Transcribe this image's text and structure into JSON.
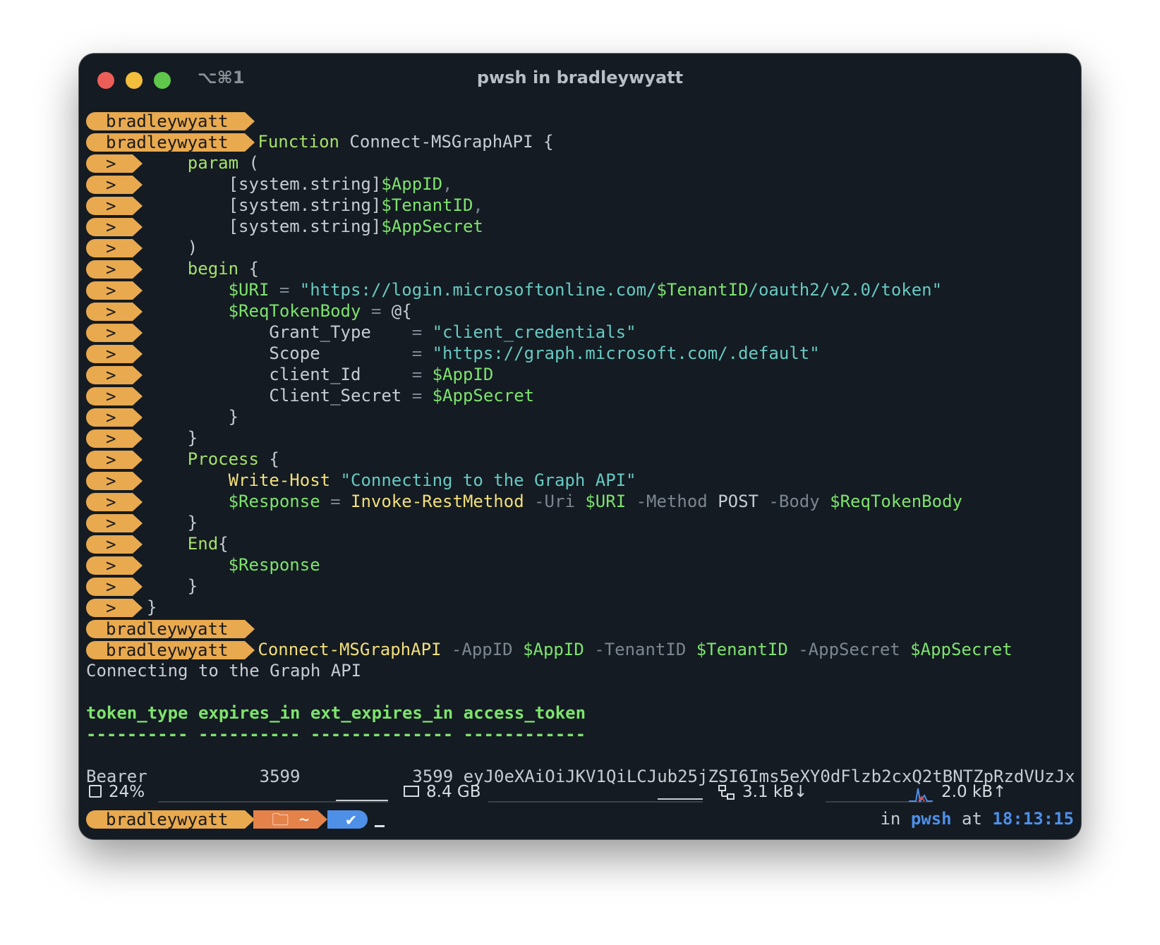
{
  "window": {
    "title": "pwsh in bradleywyatt",
    "shortcut": "⌥⌘1"
  },
  "prompt": {
    "user": "bradleywyatt",
    "cont": ">",
    "dir": "~",
    "ok": "✔",
    "shell_pre": "in ",
    "shell": "pwsh",
    "at": " at ",
    "time": "18:13:15"
  },
  "code": {
    "l1_kw": "Function",
    "l1_name": " Connect-MSGraphAPI {",
    "l2_kw": "param",
    "l2_rest": " (",
    "l3_type": "[system.string]",
    "l3_var": "$AppID",
    "l3_comma": ",",
    "l4_type": "[system.string]",
    "l4_var": "$TenantID",
    "l4_comma": ",",
    "l5_type": "[system.string]",
    "l5_var": "$AppSecret",
    "l6": ")",
    "l7_kw": "begin",
    "l7_rest": " {",
    "l8_var": "$URI",
    "l8_eq": " = ",
    "l8_str1": "\"https://login.microsoftonline.com/",
    "l8_var2": "$TenantID",
    "l8_str2": "/oauth2/v2.0/token\"",
    "l9_var": "$ReqTokenBody",
    "l9_eq": " = ",
    "l9_rest": "@{",
    "l10_key": "Grant_Type    ",
    "l10_eq": "= ",
    "l10_val": "\"client_credentials\"",
    "l11_key": "Scope         ",
    "l11_eq": "= ",
    "l11_val": "\"https://graph.microsoft.com/.default\"",
    "l12_key": "client_Id     ",
    "l12_eq": "= ",
    "l12_val": "$AppID",
    "l13_key": "Client_Secret ",
    "l13_eq": "= ",
    "l13_val": "$AppSecret",
    "l14": "}",
    "l15": "}",
    "l16_kw": "Process",
    "l16_rest": " {",
    "l17_cmd": "Write-Host",
    "l17_str": " \"Connecting to the Graph API\"",
    "l18_var": "$Response",
    "l18_eq": " = ",
    "l18_cmd": "Invoke-RestMethod",
    "l18_p1": " -Uri ",
    "l18_v1": "$URI",
    "l18_p2": " -Method ",
    "l18_v2": "POST",
    "l18_p3": " -Body ",
    "l18_v3": "$ReqTokenBody",
    "l19": "}",
    "l20_kw": "End",
    "l20_rest": "{",
    "l21_var": "$Response",
    "l22": "}",
    "l23": "}"
  },
  "invoke": {
    "cmd": "Connect-MSGraphAPI",
    "p1": " -AppID ",
    "v1": "$AppID",
    "p2": " -TenantID ",
    "v2": "$TenantID",
    "p3": " -AppSecret ",
    "v3": "$AppSecret"
  },
  "output": {
    "host_msg": "Connecting to the Graph API",
    "headers": [
      "token_type",
      "expires_in",
      "ext_expires_in",
      "access_token"
    ],
    "dashes": [
      "----------",
      "----------",
      "--------------",
      "------------"
    ],
    "row": {
      "token_type": "Bearer",
      "expires_in": "3599",
      "ext_expires_in": "3599",
      "access_token": "eyJ0eXAiOiJKV1QiLCJub25jZSI6Ims5eXY0dFlzb2cxQ2tBNTZpRzdVUzJxV…"
    }
  },
  "statusbar": {
    "cpu": "24%",
    "mem": "8.4 GB",
    "net_down": "3.1 kB↓",
    "net_up": "2.0 kB↑"
  }
}
